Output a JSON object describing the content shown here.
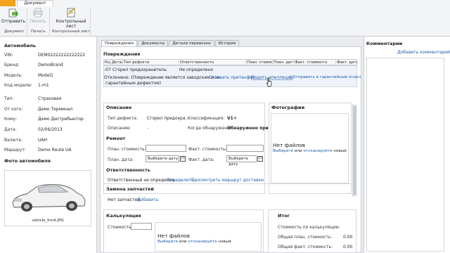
{
  "ribbon": {
    "tab_doc": "Документ",
    "buttons": [
      {
        "label": "Отправить",
        "enabled": true
      },
      {
        "label": "Печать",
        "enabled": false
      },
      {
        "label": "Контрольный лист",
        "enabled": true
      }
    ],
    "groups": [
      "Документ",
      "Печать",
      "Контрольный лист"
    ]
  },
  "vehicle": {
    "header": "Автомобиль",
    "vin_label": "VIN:",
    "vin": "DEM02222222222222",
    "brand_label": "Бренд:",
    "brand": "DemoBrand",
    "model_label": "Модель:",
    "model": "Model1",
    "model_code_label": "Код модели:",
    "model_code": "1-m1",
    "type_label": "Тип:",
    "type": "Страховая",
    "from_label": "От кого:",
    "from": "Демо Терминал",
    "to_label": "Кому:",
    "to": "Демо Дистрибьютор",
    "date_label": "Дата:",
    "date": "02/06/2013",
    "currency_label": "Валюта:",
    "currency": "UAH",
    "route_label": "Маршрут:",
    "route": "Demo Route UA",
    "photo_header": "Фото автомобиля",
    "photo_file": "vehicle_front.JPG"
  },
  "tabs": [
    "Повреждения",
    "Документы",
    "Детали перевозки",
    "История"
  ],
  "damages": {
    "header": "Повреждения",
    "columns": [
      "Код",
      "Деталь",
      "Тип дефекта",
      "Ответственность",
      "План. стоимость",
      "План. дата",
      "Факт. стоимость",
      "Факт. дата"
    ],
    "row": {
      "code": "-07",
      "defect": "Сгорел предохранитель",
      "responsibility": "Не определено"
    },
    "status_text": "Отклонено. (Повреждение является заводским или",
    "status_text2": "гарантийным дефектом)",
    "actions": [
      "Отозвать претензию",
      "Подать апелляцию",
      "Отправить в гарантийный отдел"
    ],
    "sep": "|"
  },
  "desc": {
    "header": "Описание",
    "type_label": "Тип дефекта:",
    "type": "Сгорел предохра...",
    "class_label": "Классификация:",
    "class": "V1+",
    "desc_label": "Описание:",
    "desc": "-",
    "when_label": "Когда обнаружено:",
    "when": "Обнаружено при..."
  },
  "repair": {
    "header": "Ремонт",
    "plan_cost": "План. стоимость:",
    "fact_cost": "Факт. стоимость:",
    "plan_date": "План. дата:",
    "fact_date": "Факт. дата:",
    "pick_date": "Выберите дату",
    "cal_num": "15"
  },
  "resp": {
    "header": "Ответственность",
    "text": "Ответственный не определен.",
    "link1": "Определить",
    "link2": "Просмотреть маршрут доставки"
  },
  "parts": {
    "header": "Замена запчастей",
    "text": "Нет запчастей.",
    "link": "Добавить"
  },
  "photos": {
    "header": "Фотографии",
    "no_files": "Нет файлов",
    "choose": "Выберите",
    "or": "или",
    "scan": "отсканируйте",
    "new": "новый"
  },
  "calc": {
    "header": "Калькуляция",
    "cost_label": "Стоимость:",
    "no_files": "Нет файлов",
    "choose": "Выберите",
    "or": "или",
    "scan": "отсканируйте",
    "new": "новый"
  },
  "total": {
    "header": "Итог",
    "by_calc": "Стоимость по калькуляции:",
    "plan_total": "Общая план. стоимость:",
    "plan_total_val": "0.00",
    "fact_total": "Общая факт. стоимость:",
    "fact_total_val": "0.00"
  },
  "comments": {
    "header": "Комментарии",
    "add": "Добавить комментарий"
  }
}
